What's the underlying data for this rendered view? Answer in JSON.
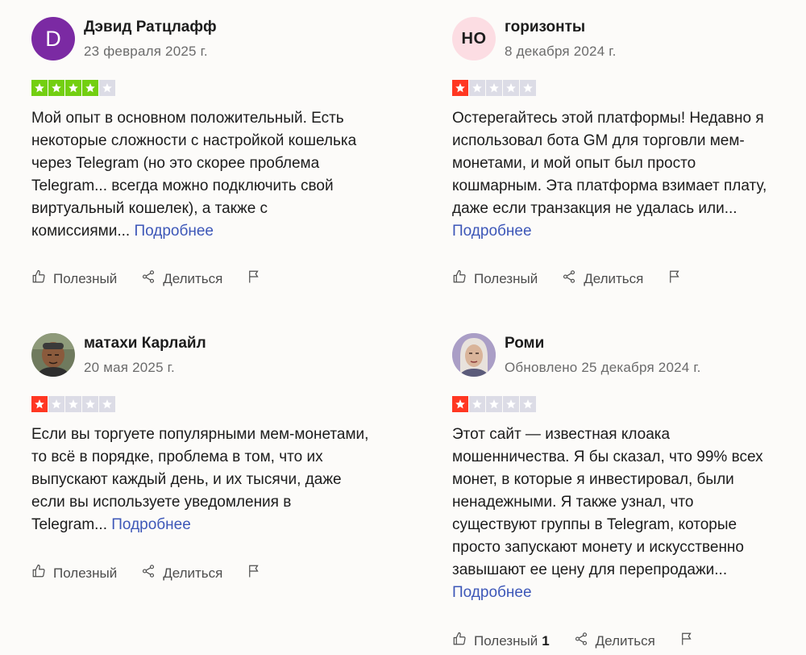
{
  "colors": {
    "star_four": "#73cf11",
    "star_one": "#ff3722",
    "star_empty": "#dcdce6",
    "link": "#3d57b8"
  },
  "actions": {
    "helpful": "Полезный",
    "share": "Делиться"
  },
  "reviews": [
    {
      "avatar": "D",
      "avatar_type": "letter",
      "name": "Дэвид Ратцлафф",
      "date": "23 февраля 2025 г.",
      "rating": 4,
      "text": "Мой опыт в основном положительный. Есть некоторые сложности с настройкой кошелька через Telegram (но это скорее проблема Telegram... всегда можно подключить свой виртуальный кошелек), а также с комиссиями...",
      "more": "Подробнее",
      "helpful_count": ""
    },
    {
      "avatar": "НО",
      "avatar_type": "initials",
      "name": "горизонты",
      "date": "8 декабря 2024 г.",
      "rating": 1,
      "text": "Остерегайтесь этой платформы! Недавно я использовал бота GM для торговли мем-монетами, и мой опыт был просто кошмарным. Эта платформа взимает плату, даже если транзакция не удалась или...",
      "more": "Подробнее",
      "helpful_count": ""
    },
    {
      "avatar": "",
      "avatar_type": "photo",
      "name": "матахи Карлайл",
      "date": "20 мая 2025 г.",
      "rating": 1,
      "text": "Если вы торгуете популярными мем-монетами, то всё в порядке, проблема в том, что их выпускают каждый день, и их тысячи, даже если вы используете уведомления в Telegram...",
      "more": "Подробнее",
      "helpful_count": ""
    },
    {
      "avatar": "",
      "avatar_type": "photo",
      "name": "Роми",
      "date": "Обновлено 25 декабря 2024 г.",
      "rating": 1,
      "text": "Этот сайт — известная клоака мошенничества. Я бы сказал, что 99% всех монет, в которые я инвестировал, были ненадежными. Я также узнал, что существуют группы в Telegram, которые просто запускают монету и искусственно завышают ее цену для перепродажи...",
      "more": "Подробнее",
      "helpful_count": "1"
    }
  ]
}
